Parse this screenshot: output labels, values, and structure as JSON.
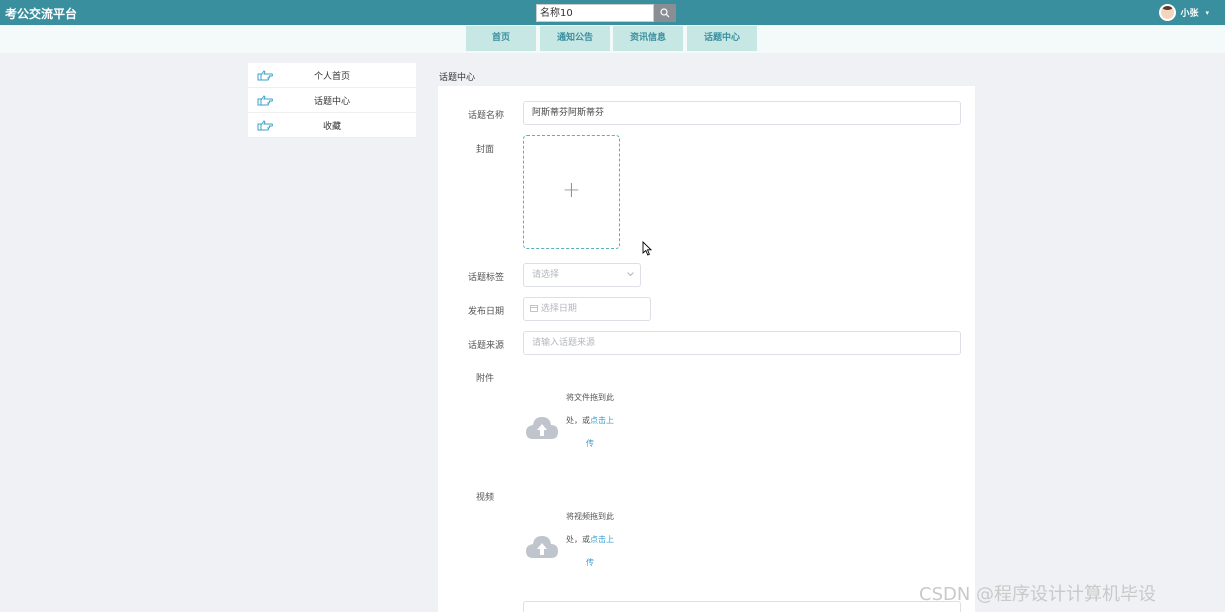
{
  "header": {
    "brand": "考公交流平台",
    "search_value": "名称10",
    "user_name": "小张",
    "caret": "▾"
  },
  "nav": [
    "首页",
    "通知公告",
    "资讯信息",
    "话题中心"
  ],
  "sidebar": {
    "items": [
      {
        "label": "个人首页"
      },
      {
        "label": "话题中心"
      },
      {
        "label": "收藏"
      }
    ]
  },
  "breadcrumb": "话题中心",
  "form": {
    "name_label": "话题名称",
    "name_value": "阿斯蒂芬阿斯蒂芬",
    "cover_label": "封面",
    "cover_plus": "+",
    "tag_label": "话题标签",
    "tag_placeholder": "请选择",
    "date_label": "发布日期",
    "date_placeholder": "选择日期",
    "source_label": "话题来源",
    "source_placeholder": "请输入话题来源",
    "attach_label": "附件",
    "attach_line1": "将文件拖到此",
    "attach_line2_prefix": "处，或",
    "attach_line2_link": "点击上",
    "attach_line3_link": "传",
    "video_label": "视频",
    "video_line1": "将视频拖到此",
    "video_line2_prefix": "处，或",
    "video_line2_link": "点击上",
    "video_line3_link": "传"
  },
  "watermark": "CSDN @程序设计计算机毕设",
  "colors": {
    "topbar": "#3a8f9e",
    "nav_item_bg": "#c7e7e5",
    "link": "#3c9dd0",
    "cover_border": "#5ab1bc"
  },
  "icons": {
    "search": "search-icon",
    "sidebar": "pointing-hand-icon",
    "upload": "cloud-upload-icon",
    "calendar": "calendar-icon",
    "chevron": "chevron-down-icon"
  }
}
